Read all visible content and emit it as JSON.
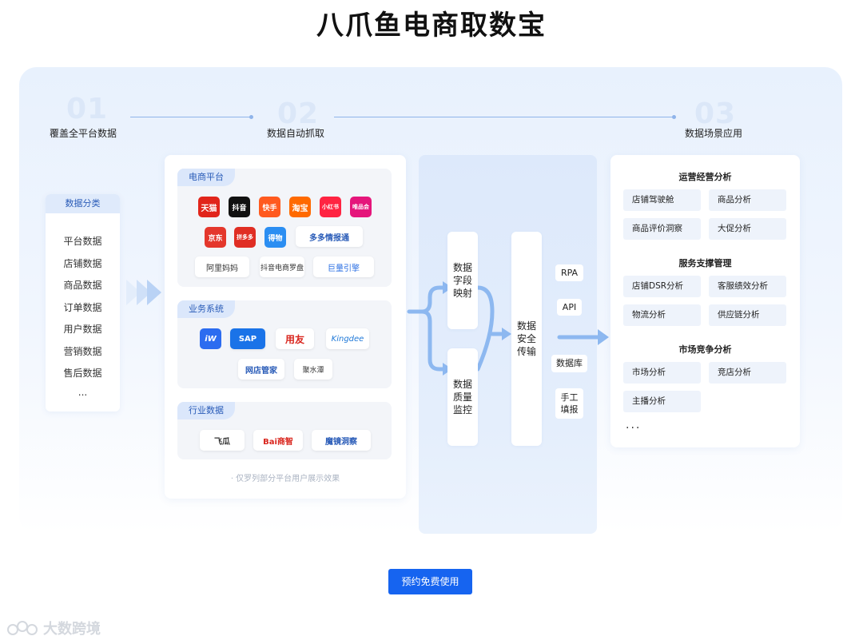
{
  "page_title": "八爪鱼电商取数宝",
  "steps": [
    {
      "num": "01",
      "label": "覆盖全平台数据"
    },
    {
      "num": "02",
      "label": "数据自动抓取"
    },
    {
      "num": "03",
      "label": "数据场景应用"
    }
  ],
  "categories": {
    "header": "数据分类",
    "items": [
      "平台数据",
      "店铺数据",
      "商品数据",
      "订单数据",
      "用户数据",
      "营销数据",
      "售后数据",
      "..."
    ]
  },
  "sources": {
    "groups": [
      {
        "tag": "电商平台",
        "logos": [
          "天猫",
          "抖音",
          "快手",
          "淘宝",
          "小红书",
          "唯品会",
          "京东",
          "拼多多",
          "得物",
          "多多情报通",
          "阿里妈妈",
          "抖音电商罗盘",
          "巨量引擎"
        ]
      },
      {
        "tag": "业务系统",
        "logos": [
          "iW",
          "SAP",
          "用友",
          "Kingdee",
          "网店管家",
          "聚水潭"
        ]
      },
      {
        "tag": "行业数据",
        "logos": [
          "飞瓜",
          "Bai商智",
          "魔镜洞察"
        ]
      }
    ],
    "note": "· 仅罗列部分平台用户展示效果"
  },
  "process": {
    "mapping": "数据\n字段\n映射",
    "quality": "数据\n质量\n监控",
    "transfer": "数据\n安全\n传输",
    "methods": [
      "RPA",
      "API",
      "数据库",
      "手工\n填报"
    ]
  },
  "applications": {
    "sections": [
      {
        "title": "运营经营分析",
        "items": [
          "店铺驾驶舱",
          "商品分析",
          "商品评价洞察",
          "大促分析"
        ]
      },
      {
        "title": "服务支撑管理",
        "items": [
          "店铺DSR分析",
          "客服绩效分析",
          "物流分析",
          "供应链分析"
        ]
      },
      {
        "title": "市场竞争分析",
        "items": [
          "市场分析",
          "竞店分析",
          "主播分析"
        ]
      }
    ],
    "more": "···"
  },
  "cta_label": "预约免费使用",
  "watermark": "大数跨境",
  "colors": {
    "accent": "#1664f0",
    "panel": "#e8f1fd",
    "tag": "#dbe7fb"
  }
}
